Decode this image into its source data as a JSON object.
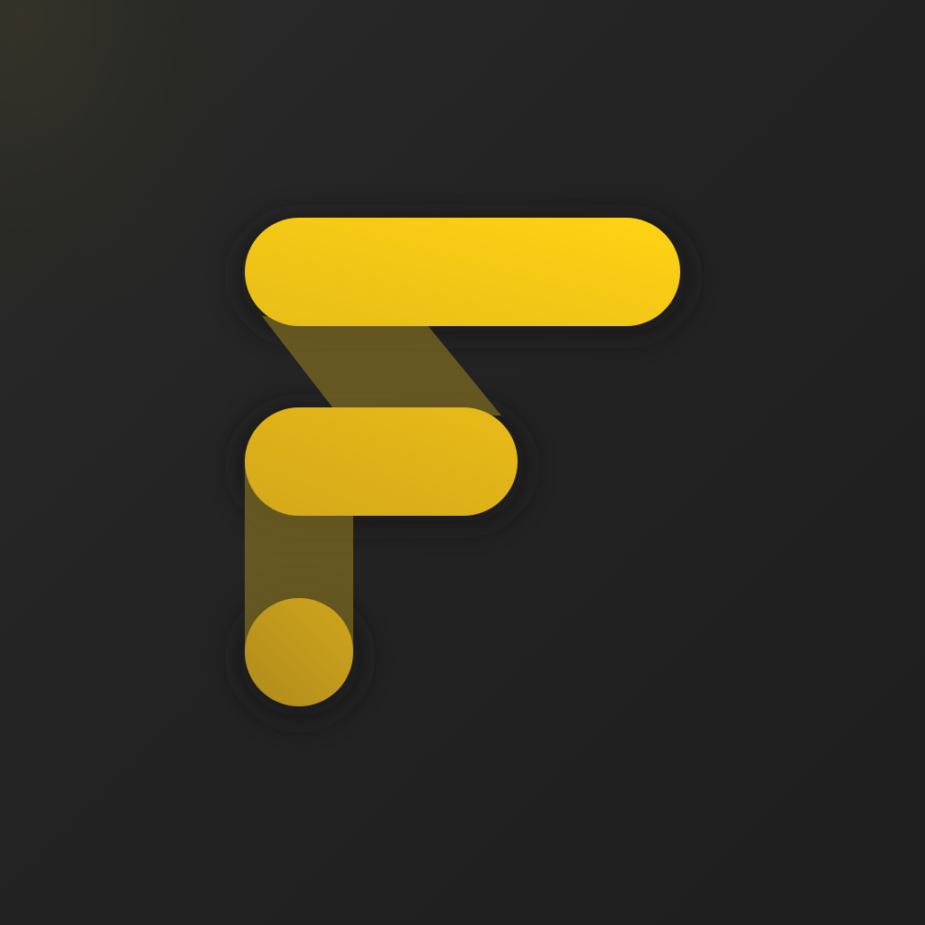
{
  "app_icon": {
    "symbol": "F",
    "colors": {
      "background": "#222222",
      "accent_bright": "#ffd313",
      "accent_mid": "#e6b91a",
      "accent_dark": "#b8901c",
      "connector": "#6b5a22"
    }
  }
}
